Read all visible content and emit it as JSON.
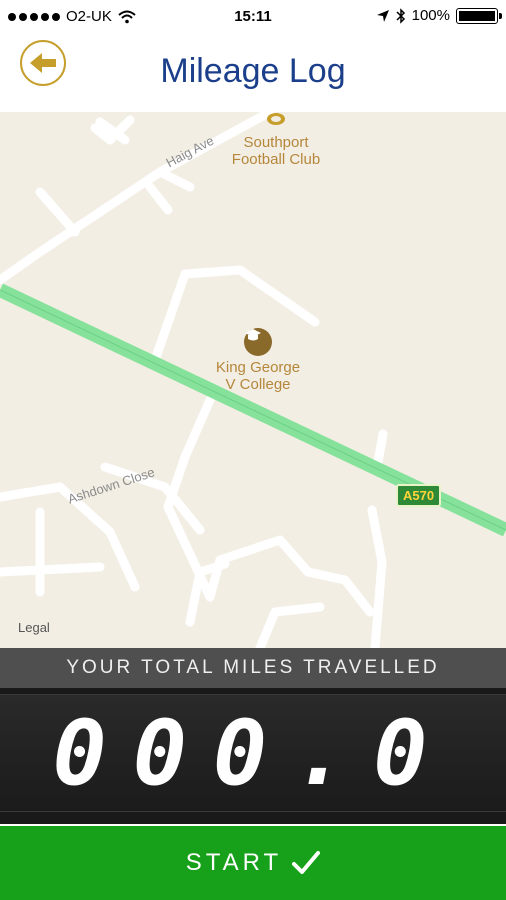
{
  "status_bar": {
    "carrier": "O2-UK",
    "time": "15:11",
    "battery": "100%"
  },
  "header": {
    "title": "Mileage Log"
  },
  "map": {
    "pois": [
      {
        "label": "Southport\nFootball Club",
        "icon": "stadium-icon"
      },
      {
        "label": "King George\nV College",
        "icon": "school-icon"
      }
    ],
    "streets": [
      "Haig Ave",
      "Ashdown Close"
    ],
    "road_shield": "A570",
    "legal": "Legal",
    "colors": {
      "land": "#f3eee4",
      "highway": "#86e29a",
      "poi": "#b4873b"
    }
  },
  "miles": {
    "header": "YOUR TOTAL MILES TRAVELLED",
    "value": "000.0"
  },
  "start_button": {
    "label": "START",
    "icon": "checkmark-icon",
    "color": "#17a11a"
  }
}
